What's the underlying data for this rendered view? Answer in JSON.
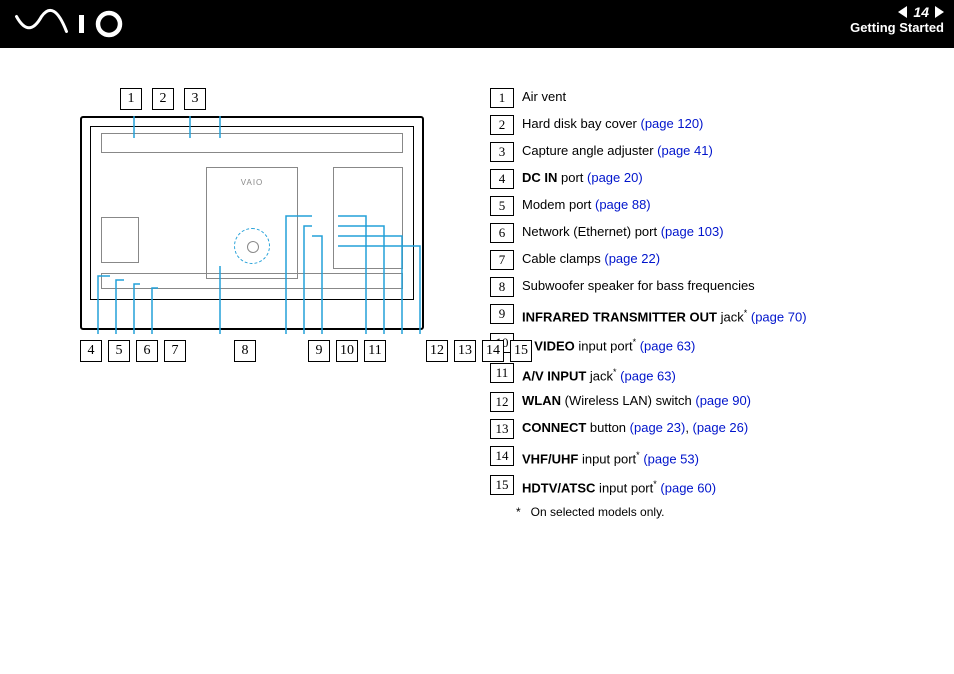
{
  "header": {
    "brand": "VAIO",
    "page_number": "14",
    "section": "Getting Started"
  },
  "diagram": {
    "top_labels": [
      "1",
      "2",
      "3"
    ],
    "bottom_group_a": [
      "4",
      "5",
      "6",
      "7"
    ],
    "bottom_group_b": [
      "8"
    ],
    "bottom_group_c": [
      "9",
      "10",
      "11"
    ],
    "bottom_group_d": [
      "12",
      "13",
      "14",
      "15"
    ],
    "center_brand": "VAIO"
  },
  "legend": [
    {
      "n": "1",
      "bold": "",
      "text": "Air vent",
      "ast": false,
      "link": ""
    },
    {
      "n": "2",
      "bold": "",
      "text": "Hard disk bay cover ",
      "ast": false,
      "link": "(page 120)"
    },
    {
      "n": "3",
      "bold": "",
      "text": "Capture angle adjuster ",
      "ast": false,
      "link": "(page 41)"
    },
    {
      "n": "4",
      "bold": "DC IN",
      "text": " port ",
      "ast": false,
      "link": "(page 20)"
    },
    {
      "n": "5",
      "bold": "",
      "text": "Modem port ",
      "ast": false,
      "link": "(page 88)"
    },
    {
      "n": "6",
      "bold": "",
      "text": "Network (Ethernet) port ",
      "ast": false,
      "link": "(page 103)"
    },
    {
      "n": "7",
      "bold": "",
      "text": "Cable clamps ",
      "ast": false,
      "link": "(page 22)"
    },
    {
      "n": "8",
      "bold": "",
      "text": "Subwoofer speaker for bass frequencies",
      "ast": false,
      "link": ""
    },
    {
      "n": "9",
      "bold": "INFRARED TRANSMITTER OUT",
      "text": " jack",
      "ast": true,
      "link": "(page 70)"
    },
    {
      "n": "10",
      "bold": "S VIDEO",
      "text": " input port",
      "ast": true,
      "link": "(page 63)"
    },
    {
      "n": "11",
      "bold": "A/V INPUT",
      "text": " jack",
      "ast": true,
      "link": "(page 63)"
    },
    {
      "n": "12",
      "bold": "WLAN",
      "text": " (Wireless LAN) switch ",
      "ast": false,
      "link": "(page 90)"
    },
    {
      "n": "13",
      "bold": "CONNECT",
      "text": " button ",
      "ast": false,
      "link": "(page 23)",
      "link2": "(page 26)"
    },
    {
      "n": "14",
      "bold": "VHF/UHF",
      "text": " input port",
      "ast": true,
      "link": "(page 53)"
    },
    {
      "n": "15",
      "bold": "HDTV/ATSC",
      "text": " input port",
      "ast": true,
      "link": "(page 60)"
    }
  ],
  "footnote": {
    "star": "*",
    "text": "On selected models only."
  }
}
